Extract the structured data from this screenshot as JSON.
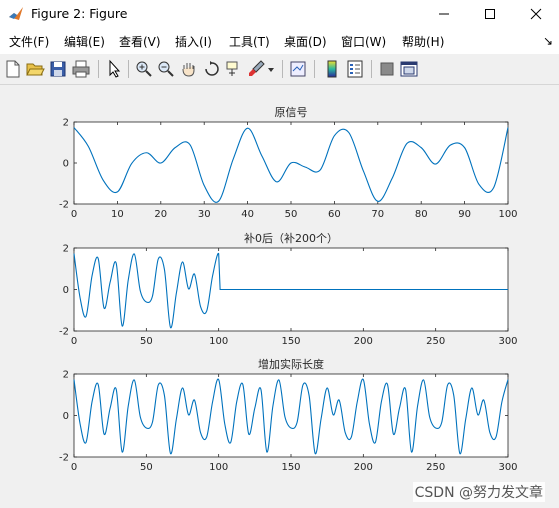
{
  "window": {
    "title": "Figure 2: Figure"
  },
  "menu": [
    "文件(F)",
    "编辑(E)",
    "查看(V)",
    "插入(I)",
    "工具(T)",
    "桌面(D)",
    "窗口(W)",
    "帮助(H)"
  ],
  "toolbar": {
    "icons": [
      "new-figure-icon",
      "open-icon",
      "save-icon",
      "print-icon",
      "pointer-icon",
      "zoom-in-icon",
      "zoom-out-icon",
      "pan-icon",
      "rotate-3d-icon",
      "data-cursor-icon",
      "brush-icon",
      "link-plot-icon",
      "colorbar-icon",
      "legend-icon",
      "hide-plot-tools-icon",
      "show-plot-tools-icon"
    ]
  },
  "watermark": "CSDN @努力发文章",
  "chart_data": [
    {
      "type": "line",
      "title": "原信号",
      "xlim": [
        0,
        100
      ],
      "ylim": [
        -2,
        2
      ],
      "xticks": [
        0,
        10,
        20,
        30,
        40,
        50,
        60,
        70,
        80,
        90,
        100
      ],
      "yticks": [
        -2,
        0,
        2
      ],
      "color": "#0072bd",
      "series": [
        {
          "x": [
            0,
            3.3,
            6.7,
            10,
            13.3,
            16.7,
            20,
            23.3,
            26.7,
            30,
            33.3,
            36.7,
            40,
            43.3,
            46.7,
            50,
            53.3,
            56.7,
            60,
            63.3,
            66.7,
            70,
            73.3,
            76.7,
            80,
            83.3,
            86.7,
            90,
            93.3,
            96.7,
            100
          ],
          "y": [
            1.73,
            0.81,
            -0.83,
            -1.41,
            -0.02,
            0.5,
            0.0,
            0.75,
            0.9,
            -1.1,
            -1.87,
            0.2,
            1.7,
            0.34,
            -0.92,
            0.0,
            -0.2,
            -0.35,
            1.33,
            1.49,
            -0.4,
            -1.87,
            -0.75,
            0.95,
            0.75,
            -0.05,
            0.87,
            0.75,
            -1.04,
            -1.2,
            1.73
          ]
        }
      ]
    },
    {
      "type": "line",
      "title": "补0后（补200个）",
      "xlim": [
        0,
        300
      ],
      "ylim": [
        -2,
        2
      ],
      "xticks": [
        0,
        50,
        100,
        150,
        200,
        250,
        300
      ],
      "yticks": [
        -2,
        0,
        2
      ],
      "color": "#0072bd",
      "series": [
        {
          "x": [
            0,
            4.2,
            8.3,
            12.5,
            16.7,
            20.8,
            25,
            29.2,
            33.3,
            37.5,
            41.7,
            45.8,
            50,
            54.2,
            58.3,
            62.5,
            66.7,
            70.8,
            75,
            79.2,
            83.3,
            87.5,
            91.7,
            95.8,
            100,
            101,
            101.5,
            300
          ],
          "y": [
            1.73,
            -0.4,
            -1.3,
            0.67,
            1.5,
            -0.9,
            0.36,
            1.26,
            -1.76,
            0.46,
            1.71,
            -0.06,
            -0.6,
            -0.33,
            1.48,
            0.97,
            -1.83,
            -0.16,
            1.33,
            0.03,
            0.74,
            -0.83,
            -1.04,
            0.66,
            1.73,
            0,
            0,
            0
          ]
        }
      ]
    },
    {
      "type": "line",
      "title": "增加实际长度",
      "xlim": [
        0,
        300
      ],
      "ylim": [
        -2,
        2
      ],
      "xticks": [
        0,
        50,
        100,
        150,
        200,
        250,
        300
      ],
      "yticks": [
        -2,
        0,
        2
      ],
      "color": "#0072bd",
      "series": [
        {
          "x": [
            0,
            4.2,
            8.3,
            12.5,
            16.7,
            20.8,
            25,
            29.2,
            33.3,
            37.5,
            41.7,
            45.8,
            50,
            54.2,
            58.3,
            62.5,
            66.7,
            70.8,
            75,
            79.2,
            83.3,
            87.5,
            91.7,
            95.8,
            100,
            104.2,
            108.3,
            112.5,
            116.7,
            120.8,
            125,
            129.2,
            133.3,
            137.5,
            141.7,
            145.8,
            150,
            154.2,
            158.3,
            162.5,
            166.7,
            170.8,
            175,
            179.2,
            183.3,
            187.5,
            191.7,
            195.8,
            200,
            204.2,
            208.3,
            212.5,
            216.7,
            220.8,
            225,
            229.2,
            233.3,
            237.5,
            241.7,
            245.8,
            250,
            254.2,
            258.3,
            262.5,
            266.7,
            270.8,
            275,
            279.2,
            283.3,
            287.5,
            291.7,
            295.8,
            300
          ],
          "y": [
            1.73,
            -0.4,
            -1.3,
            0.67,
            1.5,
            -0.9,
            0.36,
            1.26,
            -1.76,
            0.46,
            1.71,
            -0.06,
            -0.6,
            -0.33,
            1.48,
            0.97,
            -1.83,
            -0.16,
            1.33,
            0.03,
            0.74,
            -0.83,
            -1.04,
            0.66,
            1.73,
            -0.4,
            -1.3,
            0.67,
            1.5,
            -0.9,
            0.36,
            1.26,
            -1.76,
            0.46,
            1.71,
            -0.06,
            -0.6,
            -0.33,
            1.48,
            0.97,
            -1.83,
            -0.16,
            1.33,
            0.03,
            0.74,
            -0.83,
            -1.04,
            0.66,
            1.73,
            -0.4,
            -1.3,
            0.67,
            1.5,
            -0.9,
            0.36,
            1.26,
            -1.76,
            0.46,
            1.71,
            -0.06,
            -0.6,
            -0.33,
            1.48,
            0.97,
            -1.83,
            -0.16,
            1.33,
            0.03,
            0.74,
            -0.83,
            -1.04,
            0.66,
            1.73
          ]
        }
      ]
    }
  ]
}
